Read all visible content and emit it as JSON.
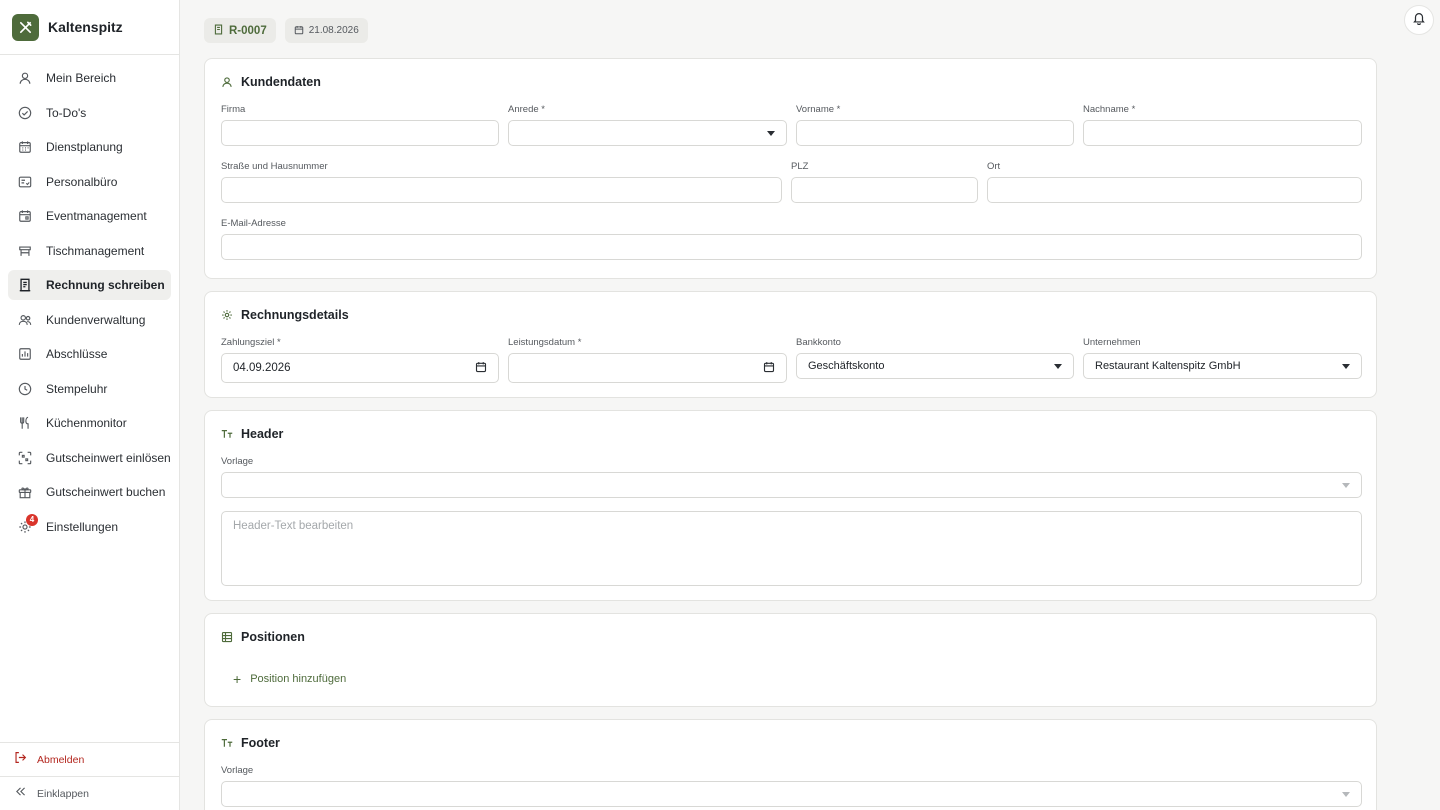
{
  "app": {
    "name": "Kaltenspitz"
  },
  "nav": [
    {
      "label": "Mein Bereich",
      "icon": "user-icon"
    },
    {
      "label": "To-Do's",
      "icon": "check-circle-icon"
    },
    {
      "label": "Dienstplanung",
      "icon": "calendar-grid-icon"
    },
    {
      "label": "Personalbüro",
      "icon": "id-card-icon"
    },
    {
      "label": "Eventmanagement",
      "icon": "calendar-icon"
    },
    {
      "label": "Tischmanagement",
      "icon": "table-icon"
    },
    {
      "label": "Rechnung schreiben",
      "icon": "receipt-icon",
      "active": true
    },
    {
      "label": "Kundenverwaltung",
      "icon": "users-icon"
    },
    {
      "label": "Abschlüsse",
      "icon": "chart-icon"
    },
    {
      "label": "Stempeluhr",
      "icon": "clock-icon"
    },
    {
      "label": "Küchenmonitor",
      "icon": "utensils-icon"
    },
    {
      "label": "Gutscheinwert einlösen",
      "icon": "scan-icon"
    },
    {
      "label": "Gutscheinwert buchen",
      "icon": "gift-icon"
    },
    {
      "label": "Einstellungen",
      "icon": "gear-icon",
      "badge": "4"
    }
  ],
  "footer_nav": {
    "logout": "Abmelden",
    "collapse": "Einklappen"
  },
  "header": {
    "invoice_id": "R-0007",
    "date": "21.08.2026"
  },
  "kunde": {
    "title": "Kundendaten",
    "firma_label": "Firma",
    "firma_value": "",
    "anrede_label": "Anrede *",
    "anrede_value": "",
    "vorname_label": "Vorname *",
    "vorname_value": "",
    "nachname_label": "Nachname *",
    "nachname_value": "",
    "strasse_label": "Straße und Hausnummer",
    "strasse_value": "",
    "plz_label": "PLZ",
    "plz_value": "",
    "ort_label": "Ort",
    "ort_value": "",
    "email_label": "E-Mail-Adresse",
    "email_value": ""
  },
  "details": {
    "title": "Rechnungsdetails",
    "zahlungsziel_label": "Zahlungsziel *",
    "zahlungsziel_value": "04.09.2026",
    "leistungsdatum_label": "Leistungsdatum *",
    "leistungsdatum_value": "",
    "bankkonto_label": "Bankkonto",
    "bankkonto_value": "Geschäftskonto",
    "unternehmen_label": "Unternehmen",
    "unternehmen_value": "Restaurant Kaltenspitz GmbH"
  },
  "header_section": {
    "title": "Header",
    "vorlage_label": "Vorlage",
    "vorlage_value": "",
    "text_placeholder": "Header-Text bearbeiten"
  },
  "positionen": {
    "title": "Positionen",
    "add_label": "Position hinzufügen"
  },
  "footer_section": {
    "title": "Footer",
    "vorlage_label": "Vorlage",
    "vorlage_value": ""
  },
  "colors": {
    "accent": "#4e6b3b",
    "danger": "#b3261e",
    "badge": "#d9342b"
  }
}
